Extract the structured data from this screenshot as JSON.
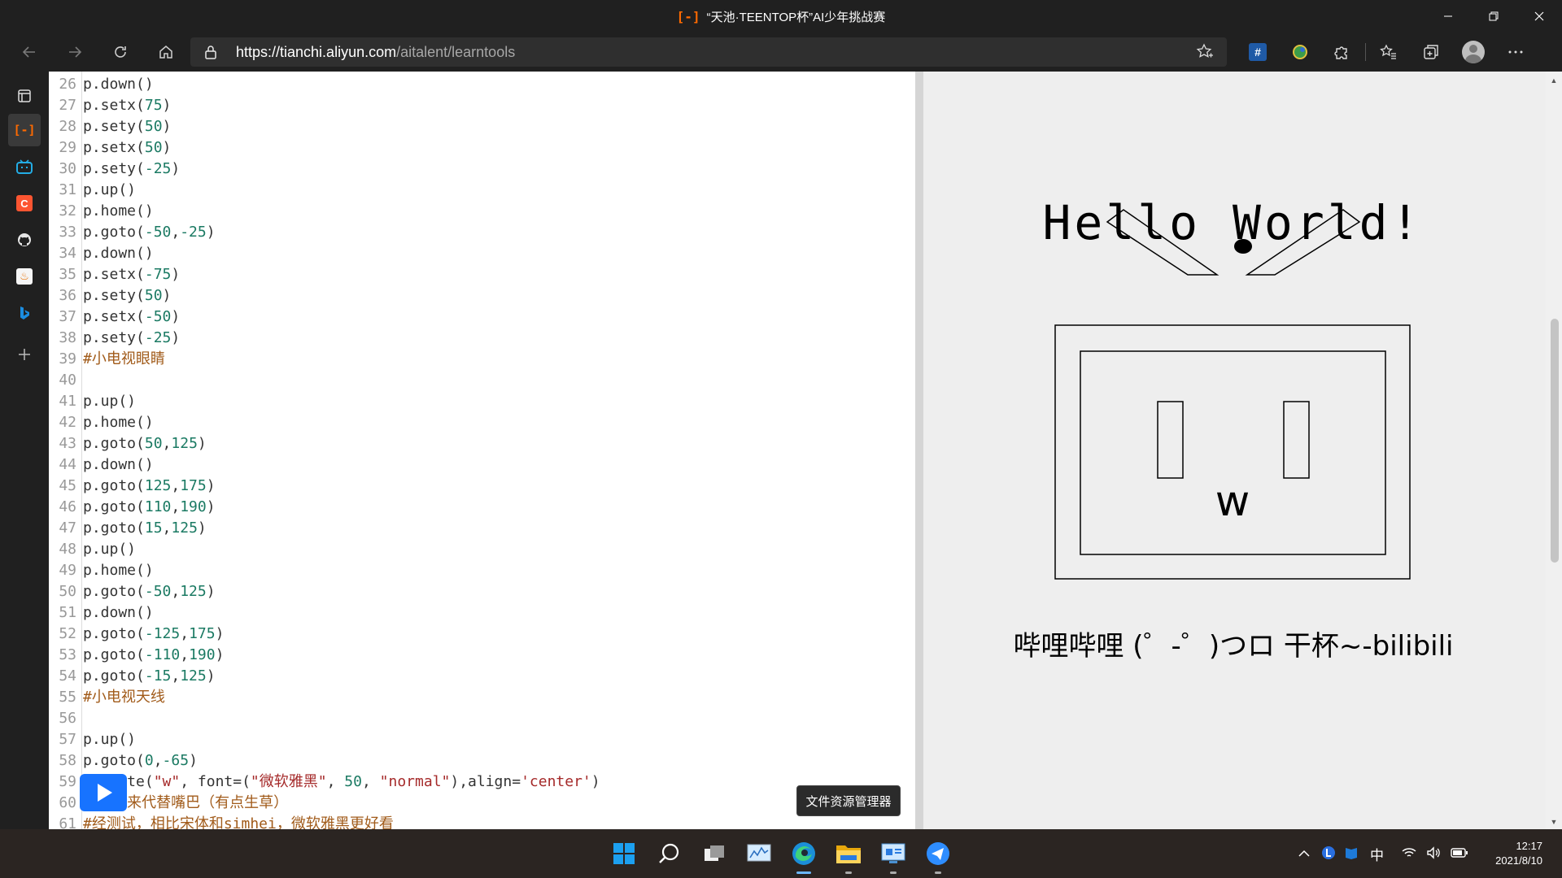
{
  "window": {
    "title": "“天池·TEENTOP杯”AI少年挑战赛",
    "brand_glyph": "[-]"
  },
  "address_bar": {
    "url_host": "https://tianchi.aliyun.com",
    "url_path": "/aitalent/learntools"
  },
  "toolbar": {
    "hash_label": "#"
  },
  "code": {
    "lines": [
      {
        "n": "26",
        "t": "p.down()",
        "kind": "code"
      },
      {
        "n": "27",
        "t": "p.setx(75)",
        "kind": "code"
      },
      {
        "n": "28",
        "t": "p.sety(50)",
        "kind": "code"
      },
      {
        "n": "29",
        "t": "p.setx(50)",
        "kind": "code"
      },
      {
        "n": "30",
        "t": "p.sety(-25)",
        "kind": "code"
      },
      {
        "n": "31",
        "t": "p.up()",
        "kind": "code"
      },
      {
        "n": "32",
        "t": "p.home()",
        "kind": "code"
      },
      {
        "n": "33",
        "t": "p.goto(-50,-25)",
        "kind": "code"
      },
      {
        "n": "34",
        "t": "p.down()",
        "kind": "code"
      },
      {
        "n": "35",
        "t": "p.setx(-75)",
        "kind": "code"
      },
      {
        "n": "36",
        "t": "p.sety(50)",
        "kind": "code"
      },
      {
        "n": "37",
        "t": "p.setx(-50)",
        "kind": "code"
      },
      {
        "n": "38",
        "t": "p.sety(-25)",
        "kind": "code"
      },
      {
        "n": "39",
        "t": "#小电视眼睛",
        "kind": "comment"
      },
      {
        "n": "40",
        "t": "",
        "kind": "code"
      },
      {
        "n": "41",
        "t": "p.up()",
        "kind": "code"
      },
      {
        "n": "42",
        "t": "p.home()",
        "kind": "code"
      },
      {
        "n": "43",
        "t": "p.goto(50,125)",
        "kind": "code"
      },
      {
        "n": "44",
        "t": "p.down()",
        "kind": "code"
      },
      {
        "n": "45",
        "t": "p.goto(125,175)",
        "kind": "code"
      },
      {
        "n": "46",
        "t": "p.goto(110,190)",
        "kind": "code"
      },
      {
        "n": "47",
        "t": "p.goto(15,125)",
        "kind": "code"
      },
      {
        "n": "48",
        "t": "p.up()",
        "kind": "code"
      },
      {
        "n": "49",
        "t": "p.home()",
        "kind": "code"
      },
      {
        "n": "50",
        "t": "p.goto(-50,125)",
        "kind": "code"
      },
      {
        "n": "51",
        "t": "p.down()",
        "kind": "code"
      },
      {
        "n": "52",
        "t": "p.goto(-125,175)",
        "kind": "code"
      },
      {
        "n": "53",
        "t": "p.goto(-110,190)",
        "kind": "code"
      },
      {
        "n": "54",
        "t": "p.goto(-15,125)",
        "kind": "code"
      },
      {
        "n": "55",
        "t": "#小电视天线",
        "kind": "comment"
      },
      {
        "n": "56",
        "t": "",
        "kind": "code"
      },
      {
        "n": "57",
        "t": "p.up()",
        "kind": "code"
      },
      {
        "n": "58",
        "t": "p.goto(0,-65)",
        "kind": "code"
      },
      {
        "n": "59",
        "t": "    ite(\"w\", font=(\"微软雅黑\", 50, \"normal\"),align='center')",
        "kind": "code"
      },
      {
        "n": "60",
        "t": "    w来代替嘴巴（有点生草）",
        "kind": "comment"
      },
      {
        "n": "61",
        "t": "#经测试，相比宋体和simhei，微软雅黑更好看",
        "kind": "comment"
      }
    ]
  },
  "output": {
    "hello_text": "Hello World!",
    "mouth_text": "w",
    "caption": "哔哩哔哩 (゜-゜)つロ 干杯~-bilibili"
  },
  "tooltip": {
    "text": "文件资源管理器"
  },
  "tray": {
    "ime": "中"
  },
  "clock": {
    "time": "12:17",
    "date": "2021/8/10"
  }
}
